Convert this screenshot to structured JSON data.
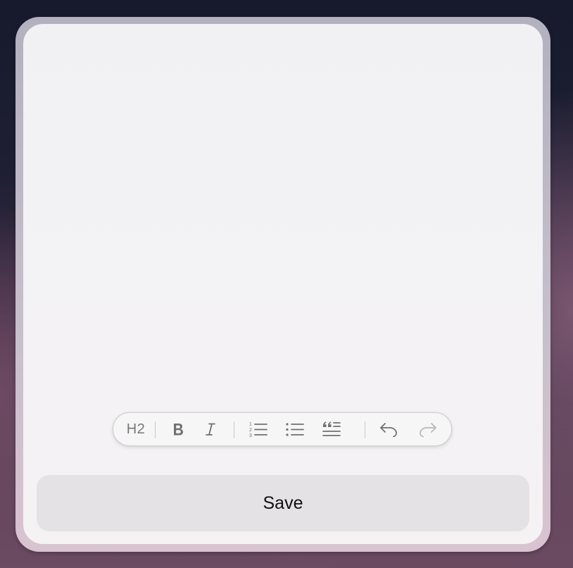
{
  "toolbar": {
    "heading_label": "H2",
    "buttons": [
      {
        "name": "heading",
        "icon": "heading-h2-icon"
      },
      {
        "name": "bold",
        "icon": "bold-icon"
      },
      {
        "name": "italic",
        "icon": "italic-icon"
      },
      {
        "name": "ordered-list",
        "icon": "ordered-list-icon"
      },
      {
        "name": "bullet-list",
        "icon": "bullet-list-icon"
      },
      {
        "name": "blockquote",
        "icon": "quote-icon"
      },
      {
        "name": "undo",
        "icon": "undo-icon"
      },
      {
        "name": "redo",
        "icon": "redo-icon",
        "disabled": true
      }
    ]
  },
  "actions": {
    "save_label": "Save"
  },
  "colors": {
    "icon": "#707070",
    "icon_disabled": "#b8b8b8",
    "panel_background": "#f2f1f3",
    "save_button_background": "#e4e2e4"
  }
}
